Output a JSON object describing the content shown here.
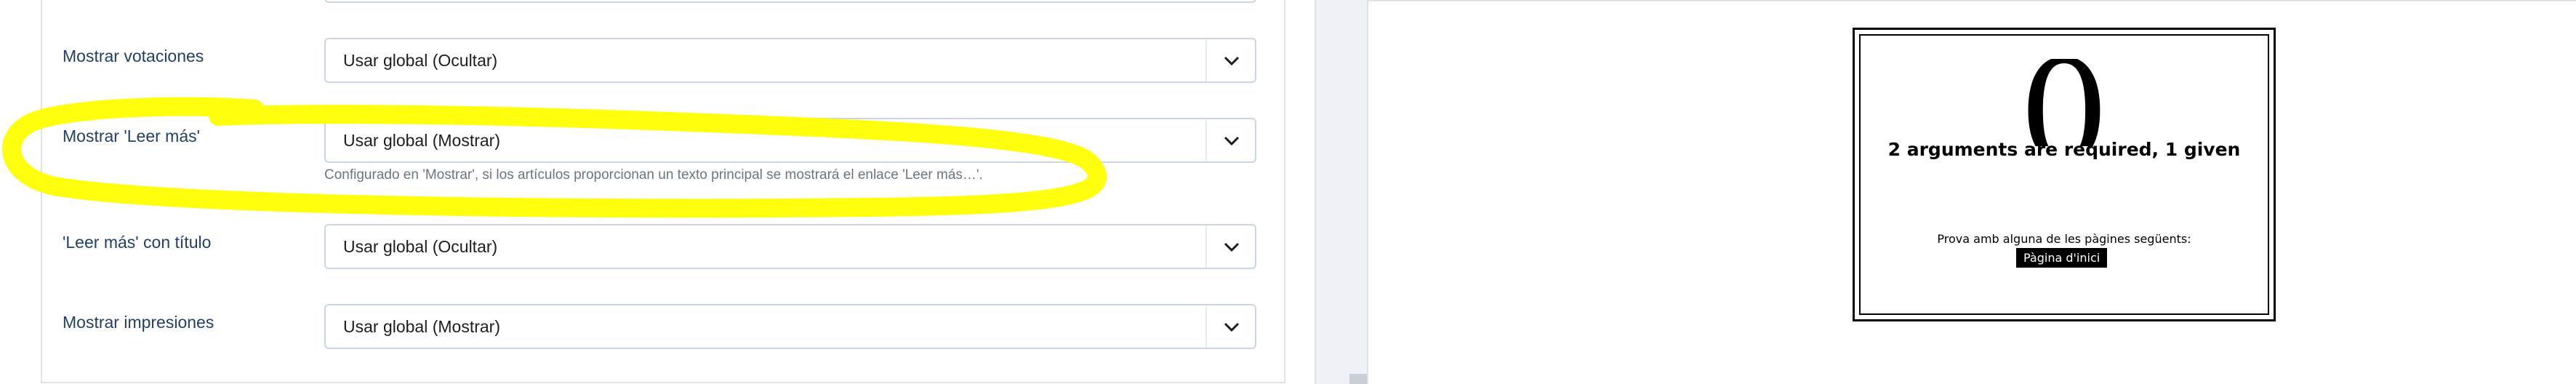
{
  "form": {
    "fields": [
      {
        "label": "Mostrar votaciones",
        "value": "Usar global (Ocultar)"
      },
      {
        "label": "Mostrar 'Leer más'",
        "value": "Usar global (Mostrar)",
        "hint": "Configurado en 'Mostrar', si los artículos proporcionan un texto principal se mostrará el enlace 'Leer más…'."
      },
      {
        "label": "'Leer más' con título",
        "value": "Usar global (Ocultar)"
      },
      {
        "label": "Mostrar impresiones",
        "value": "Usar global (Mostrar)"
      }
    ]
  },
  "highlight_color": "#ffff00",
  "preview": {
    "error_code": "0",
    "error_title": "2 arguments are required, 1 given",
    "suggestion": "Prova amb alguna de les pàgines següents:",
    "home_link": "Pàgina d'inici"
  }
}
